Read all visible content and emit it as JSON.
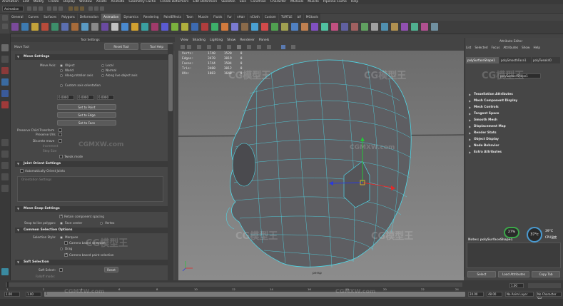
{
  "menubar": [
    "Animation",
    "Edit",
    "Modify",
    "Create",
    "Display",
    "Window",
    "Assets",
    "Animate",
    "Geometry Cache",
    "Create Deformers",
    "Edit Deformers",
    "Skeleton",
    "Skin",
    "Constrain",
    "Character",
    "MGtools",
    "Muscle",
    "Pipeline Cache",
    "Help"
  ],
  "mode_select": "Animation",
  "shelf_tabs": [
    "General",
    "Curves",
    "Surfaces",
    "Polygons",
    "Deformation",
    "Animation",
    "Dynamics",
    "Rendering",
    "PaintEffects",
    "Toon",
    "Muscle",
    "Fluids",
    "Fur",
    "nHair",
    "nCloth",
    "Custom",
    "TURTLE",
    "bif",
    "MGtools"
  ],
  "shelf_active": "Animation",
  "tool_settings": {
    "title": "Tool Settings",
    "tool_name": "Move Tool",
    "reset_tool": "Reset Tool",
    "tool_help": "Tool Help",
    "move_settings": "Move Settings",
    "move_axis": "Move Axis:",
    "object": "Object",
    "local": "Local",
    "world": "World",
    "normal": "Normal",
    "along_rotation_axis": "Along rotation axis",
    "along_live_object_axis": "Along live object axis",
    "custom_axis_orientation": "Custom axis orientation",
    "field_x": "0.0000",
    "field_y": "0.0000",
    "field_z": "0.0000",
    "set_to_point": "Set to Point",
    "set_to_edge": "Set to Edge",
    "set_to_face": "Set to Face",
    "preserve_child": "Preserve Child Transform",
    "preserve_uvs": "Preserve UVs",
    "discrete_move": "Discrete move",
    "increment": "Increment",
    "step_size": "Step Size",
    "tweak_mode": "Tweak mode",
    "joint_orient": "Joint Orient Settings",
    "auto_orient": "Automatically Orient Joints",
    "orientation_settings": "Orientation Settings",
    "move_snap": "Move Snap Settings",
    "retain_spacing": "Retain component spacing",
    "snap_live": "Snap to live polygon:",
    "face_center": "Face center",
    "vertex": "Vertex",
    "common_selection": "Common Selection Options",
    "selection_style": "Selection Style:",
    "marquee": "Marquee",
    "camera_based": "Camera based selection",
    "drag": "Drag",
    "camera_based_paint": "Camera based paint selection",
    "soft_selection": "Soft Selection",
    "soft_select": "Soft Select:",
    "falloff_mode": "Falloff mode:",
    "reset": "Reset"
  },
  "viewport": {
    "menu": [
      "View",
      "Shading",
      "Lighting",
      "Show",
      "Renderer",
      "Panels"
    ],
    "hud": [
      {
        "label": "Verts:",
        "a": "1740",
        "b": "1520",
        "c": "0"
      },
      {
        "label": "Edges:",
        "a": "3470",
        "b": "3019",
        "c": "0"
      },
      {
        "label": "Faces:",
        "a": "1744",
        "b": "1504",
        "c": "0"
      },
      {
        "label": "Tris:",
        "a": "3488",
        "b": "3012",
        "c": "0"
      },
      {
        "label": "UVs:",
        "a": "1883",
        "b": "1648",
        "c": "0"
      }
    ],
    "camera": "persp"
  },
  "attribute_editor": {
    "title": "Attribute Editor",
    "menu": [
      "List",
      "Selected",
      "Focus",
      "Attributes",
      "Show",
      "Help"
    ],
    "tabs": [
      "polySurfaceShape1",
      "polySmoothFace1",
      "polyTweak40"
    ],
    "name_label": "polySurfaceShape1",
    "sections": [
      "Tessellation Attributes",
      "Mesh Component Display",
      "Mesh Controls",
      "Tangent Space",
      "Smooth Mesh",
      "Displacement Map",
      "Render Stats",
      "Object Display",
      "Node Behavior",
      "Extra Attributes"
    ],
    "notes": "Notes: polySurfaceShape1",
    "select": "Select",
    "load_attributes": "Load Attributes",
    "copy_tab": "Copy Tab"
  },
  "time": {
    "ticks": [
      "1",
      "2",
      "4",
      "6",
      "8",
      "10",
      "12",
      "14",
      "16",
      "18",
      "20",
      "22",
      "24"
    ],
    "range_start": "1.00",
    "range_inner": "1.00",
    "current": "1",
    "end_a": "24.00",
    "end_b": "48.00",
    "anim_layer": "No Anim Layer",
    "char_set": "No Character Set",
    "current_time": "1.00"
  },
  "overlay": {
    "cpu_pct": "27%",
    "temp": "37°c",
    "temp2": "39°C",
    "cpu_label": "CPU温度"
  },
  "watermarks": [
    "CGMXW.com",
    "CG模型王"
  ]
}
